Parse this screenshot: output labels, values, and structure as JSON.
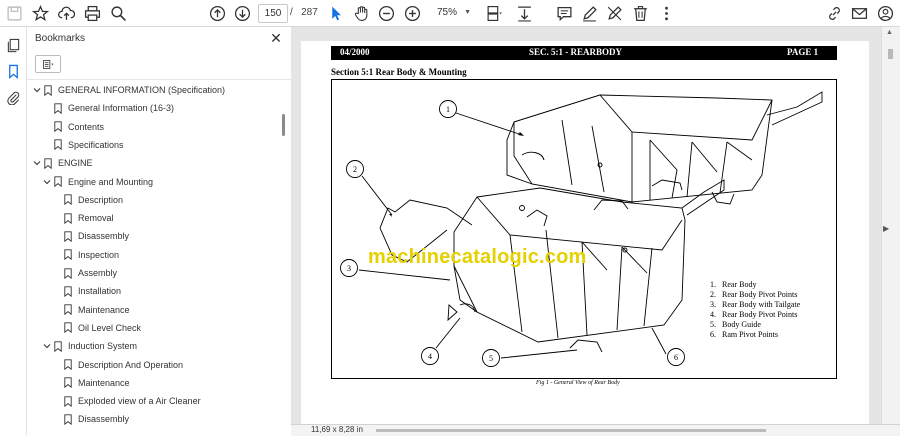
{
  "toolbar": {
    "page_current": "150",
    "page_separator": "/",
    "page_total": "287",
    "zoom": "75%"
  },
  "bookmarks_panel": {
    "title": "Bookmarks",
    "items": [
      {
        "label": "GENERAL INFORMATION (Specification)",
        "level": 0,
        "expanded": true
      },
      {
        "label": "General Information (16-3)",
        "level": 1
      },
      {
        "label": "Contents",
        "level": 1
      },
      {
        "label": "Specifications",
        "level": 1
      },
      {
        "label": "ENGINE",
        "level": 0,
        "expanded": true
      },
      {
        "label": "Engine and Mounting",
        "level": 1,
        "expanded": true
      },
      {
        "label": "Description",
        "level": 2
      },
      {
        "label": "Removal",
        "level": 2
      },
      {
        "label": "Disassembly",
        "level": 2
      },
      {
        "label": "Inspection",
        "level": 2
      },
      {
        "label": "Assembly",
        "level": 2
      },
      {
        "label": "Installation",
        "level": 2
      },
      {
        "label": "Maintenance",
        "level": 2
      },
      {
        "label": "Oil Level Check",
        "level": 2
      },
      {
        "label": "Induction System",
        "level": 1,
        "expanded": true
      },
      {
        "label": "Description And Operation",
        "level": 2
      },
      {
        "label": "Maintenance",
        "level": 2
      },
      {
        "label": "Exploded view of a Air Cleaner",
        "level": 2
      },
      {
        "label": "Disassembly",
        "level": 2
      }
    ]
  },
  "document": {
    "header_date": "04/2000",
    "header_section": "SEC. 5:1 - REARBODY",
    "header_page": "PAGE 1",
    "section_title": "Section 5:1  Rear Body & Mounting",
    "callouts": [
      "1",
      "2",
      "3",
      "4",
      "5",
      "6"
    ],
    "legend": [
      {
        "num": "1.",
        "text": "Rear Body"
      },
      {
        "num": "2.",
        "text": "Rear Body Pivot Points"
      },
      {
        "num": "3.",
        "text": "Rear Body with Tailgate"
      },
      {
        "num": "4.",
        "text": "Rear Body Pivot Points"
      },
      {
        "num": "5.",
        "text": "Body Guide"
      },
      {
        "num": "6.",
        "text": "Ram Pivot Points"
      }
    ],
    "caption": "Fig 1 - General View of Rear Body",
    "watermark": "machinecatalogic.com"
  },
  "status": {
    "page_size": "11,69 x 8,28 in"
  },
  "colors": {
    "watermark": "#e5d000",
    "viewer_bg": "#e5e5e5",
    "select_tool_accent": "#1473e6"
  }
}
